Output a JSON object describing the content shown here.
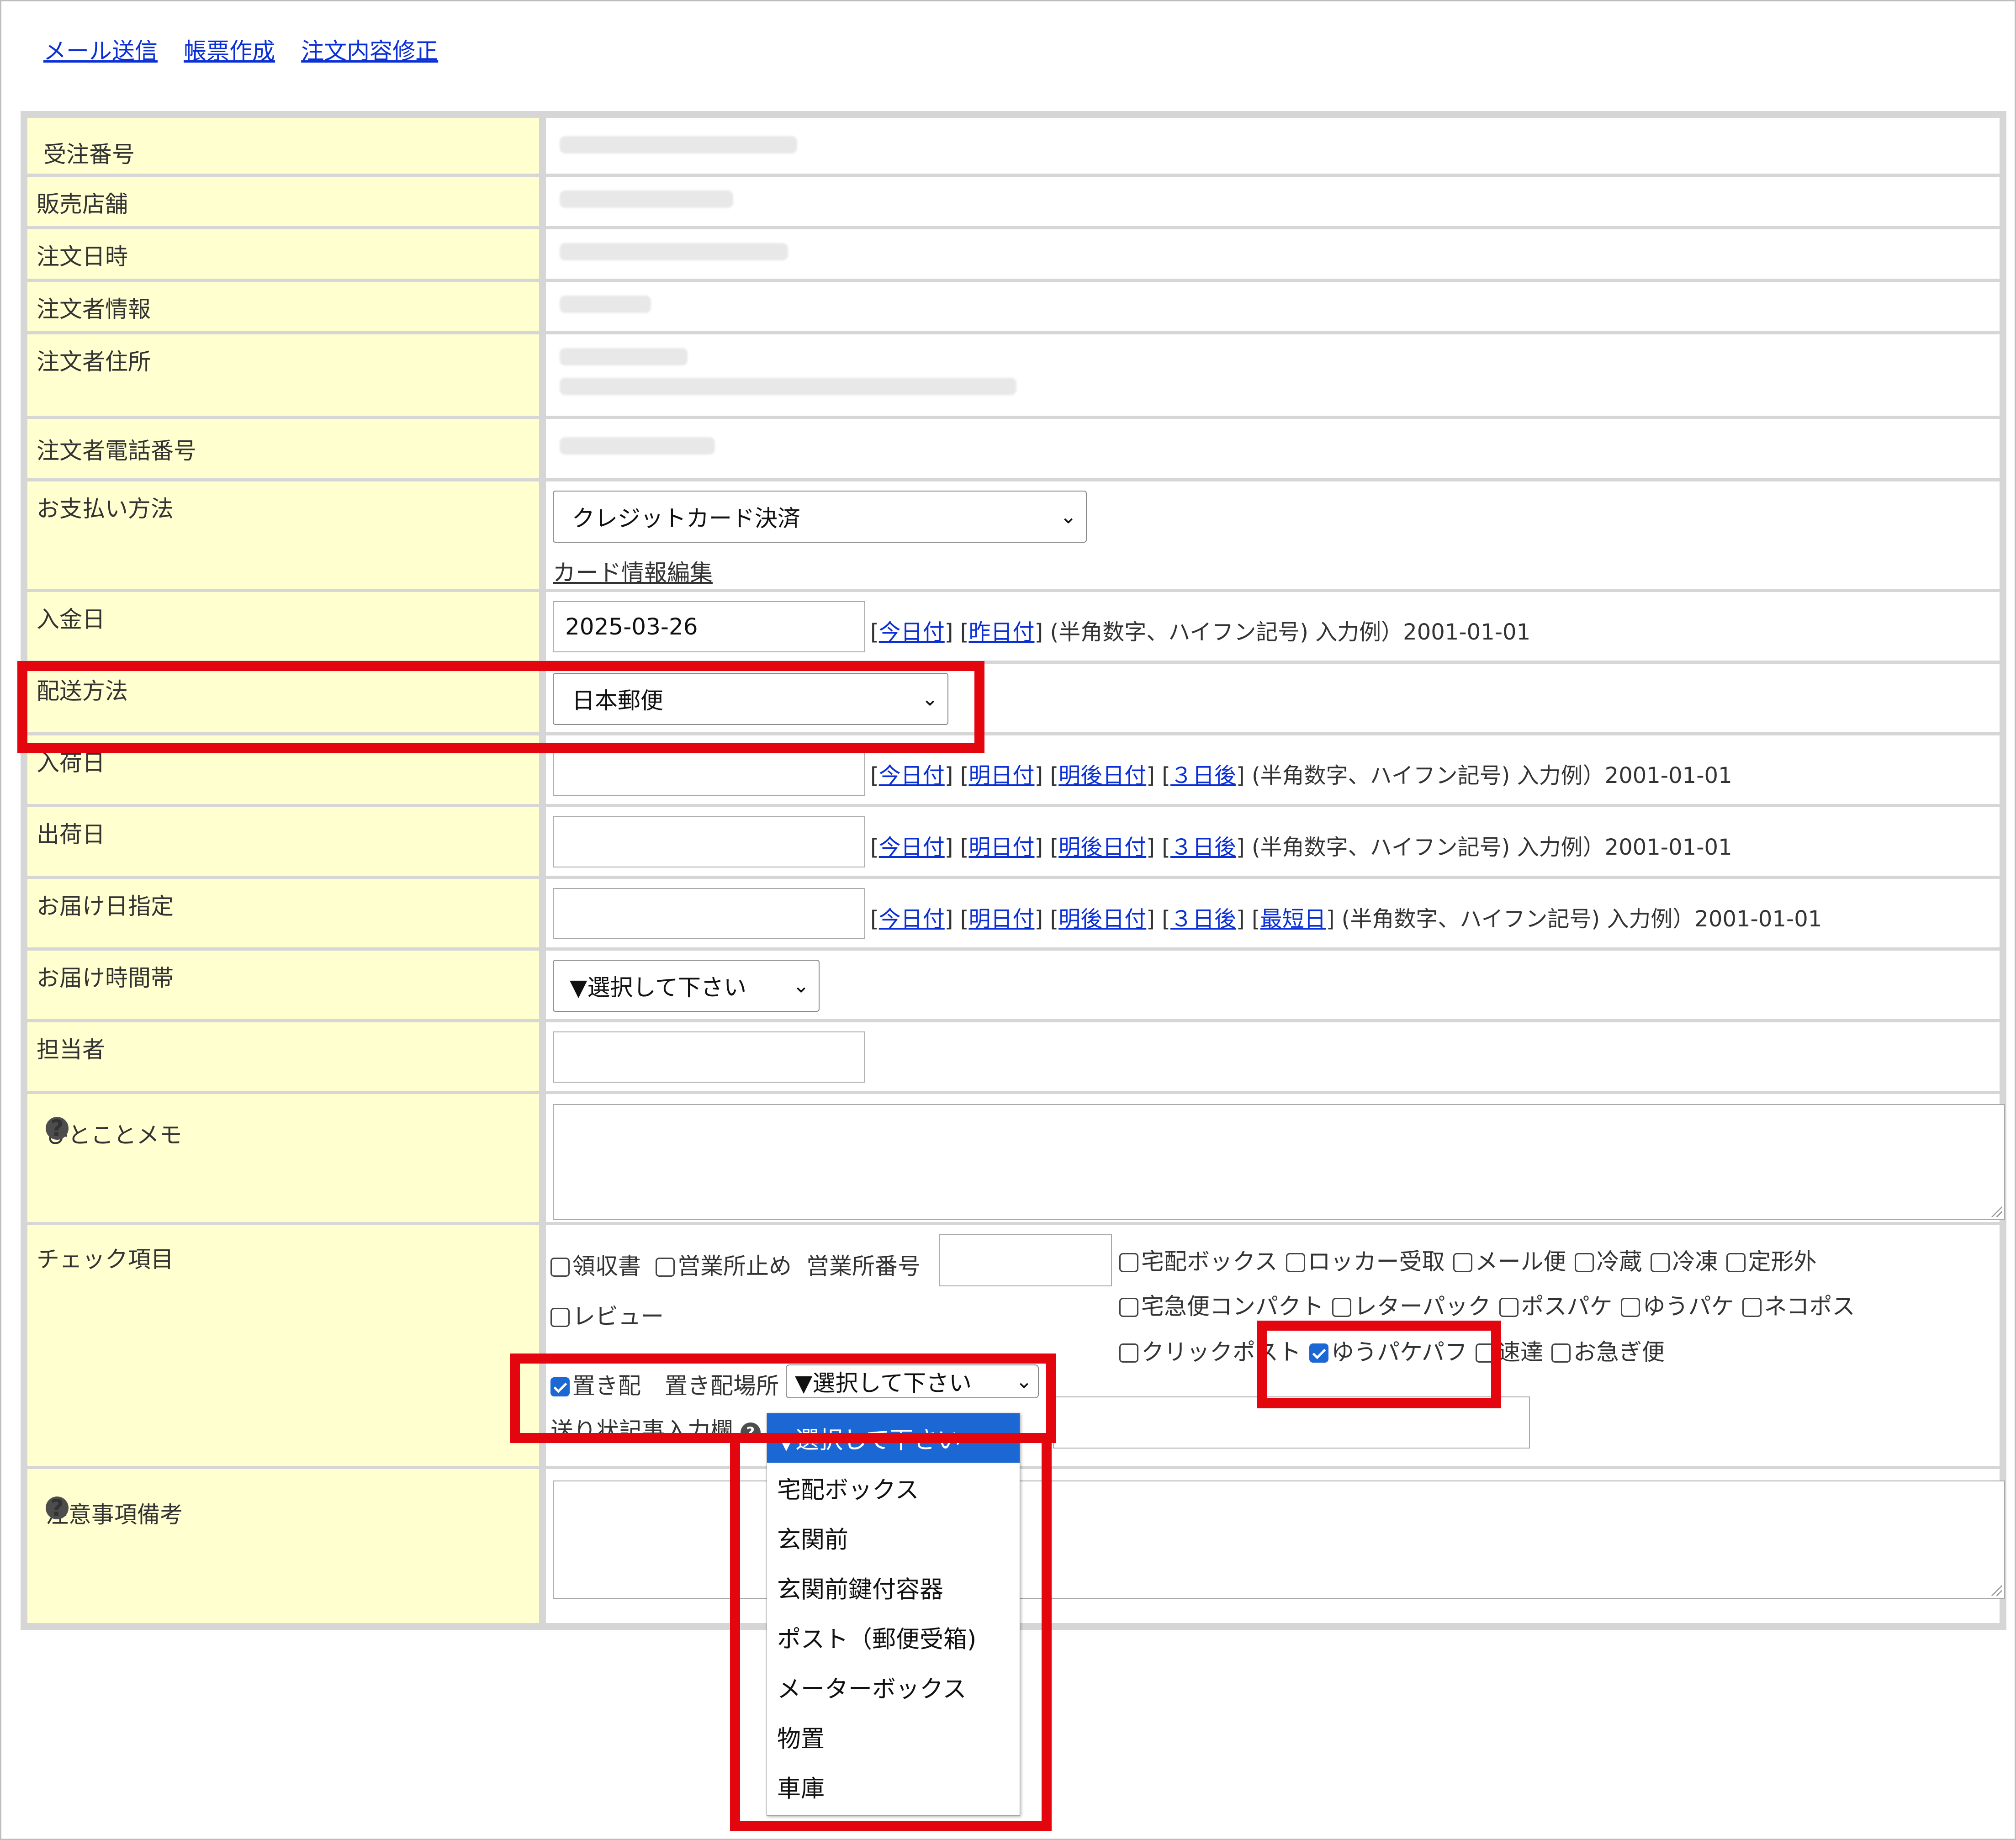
{
  "top_links": [
    "メール送信",
    "帳票作成",
    "注文内容修正"
  ],
  "labels": {
    "order_no": "受注番号",
    "shop": "販売店舗",
    "order_date": "注文日時",
    "buyer_info": "注文者情報",
    "buyer_address": "注文者住所",
    "buyer_phone": "注文者電話番号",
    "payment": "お支払い方法",
    "paid_date": "入金日",
    "shipping_method": "配送方法",
    "arrival_date": "入荷日",
    "ship_date": "出荷日",
    "delivery_date": "お届け日指定",
    "delivery_time": "お届け時間帯",
    "staff": "担当者",
    "memo": "ひとことメモ",
    "check_items": "チェック項目",
    "notes": "注意事項備考"
  },
  "help_icon": "?",
  "payment": {
    "selected": "クレジットカード決済",
    "edit_link": "カード情報編集"
  },
  "paid_date": {
    "value": "2025-03-26",
    "hint": "(半角数字、ハイフン記号) 入力例）2001-01-01"
  },
  "shipping_method": {
    "selected": "日本郵便"
  },
  "date_links": {
    "today": "今日付",
    "yesterday": "昨日付",
    "tomorrow": "明日付",
    "day_after": "明後日付",
    "three_days": "３日後",
    "earliest": "最短日"
  },
  "date_hint": "(半角数字、ハイフン記号) 入力例）2001-01-01",
  "delivery_time": {
    "selected": "▼選択して下さい"
  },
  "checks": {
    "receipt": "領収書",
    "office_hold": "営業所止め",
    "office_no_label": "営業所番号",
    "review": "レビュー",
    "okihai": "置き配",
    "okihai_place_label": "置き配場所",
    "okihai_place_selected": "▼選択して下さい",
    "slip_label": "送り状記事入力欄",
    "carriers_row1": [
      "宅配ボックス",
      "ロッカー受取",
      "メール便",
      "冷蔵",
      "冷凍",
      "定形外"
    ],
    "carriers_row2": [
      "宅急便コンパクト",
      "レターパック",
      "ポスパケ",
      "ゆうパケ",
      "ネコポス"
    ],
    "carriers_row3": [
      "クリックポスト",
      "ゆうパケパフ",
      "速達",
      "お急ぎ便"
    ],
    "checked": [
      "置き配",
      "ゆうパケパフ"
    ]
  },
  "okihai_options": [
    "▼選択して下さい",
    "宅配ボックス",
    "玄関前",
    "玄関前鍵付容器",
    "ポスト（郵便受箱)",
    "メーターボックス",
    "物置",
    "車庫"
  ],
  "colors": {
    "label_bg": "#ffffd0",
    "link": "#0b2fd6",
    "highlight_red": "#e3060f",
    "selected_blue": "#1b67d4"
  }
}
